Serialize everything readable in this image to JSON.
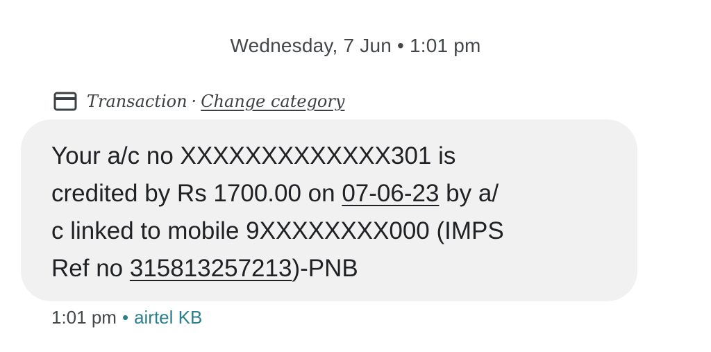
{
  "date_header": "Wednesday, 7 Jun • 1:01 pm",
  "category": {
    "icon": "credit-card-icon",
    "label": "Transaction",
    "separator": "·",
    "change_link": "Change category"
  },
  "message": {
    "line1": "Your a/c no XXXXXXXXXXXXX301 is",
    "line2_pre": "credited by Rs 1700.00 on ",
    "line2_date": "07-06-23",
    "line2_post": " by a/",
    "line3": "c linked to mobile 9XXXXXXXX000 (IMPS",
    "line4_pre": "Ref no ",
    "line4_ref": "315813257213",
    "line4_post": ")-PNB"
  },
  "meta": {
    "time": "1:01 pm",
    "separator": "•",
    "sim": "airtel KB"
  },
  "colors": {
    "bubble_bg": "#f0f1f0",
    "accent": "#2b7f8a",
    "text": "#202124"
  }
}
